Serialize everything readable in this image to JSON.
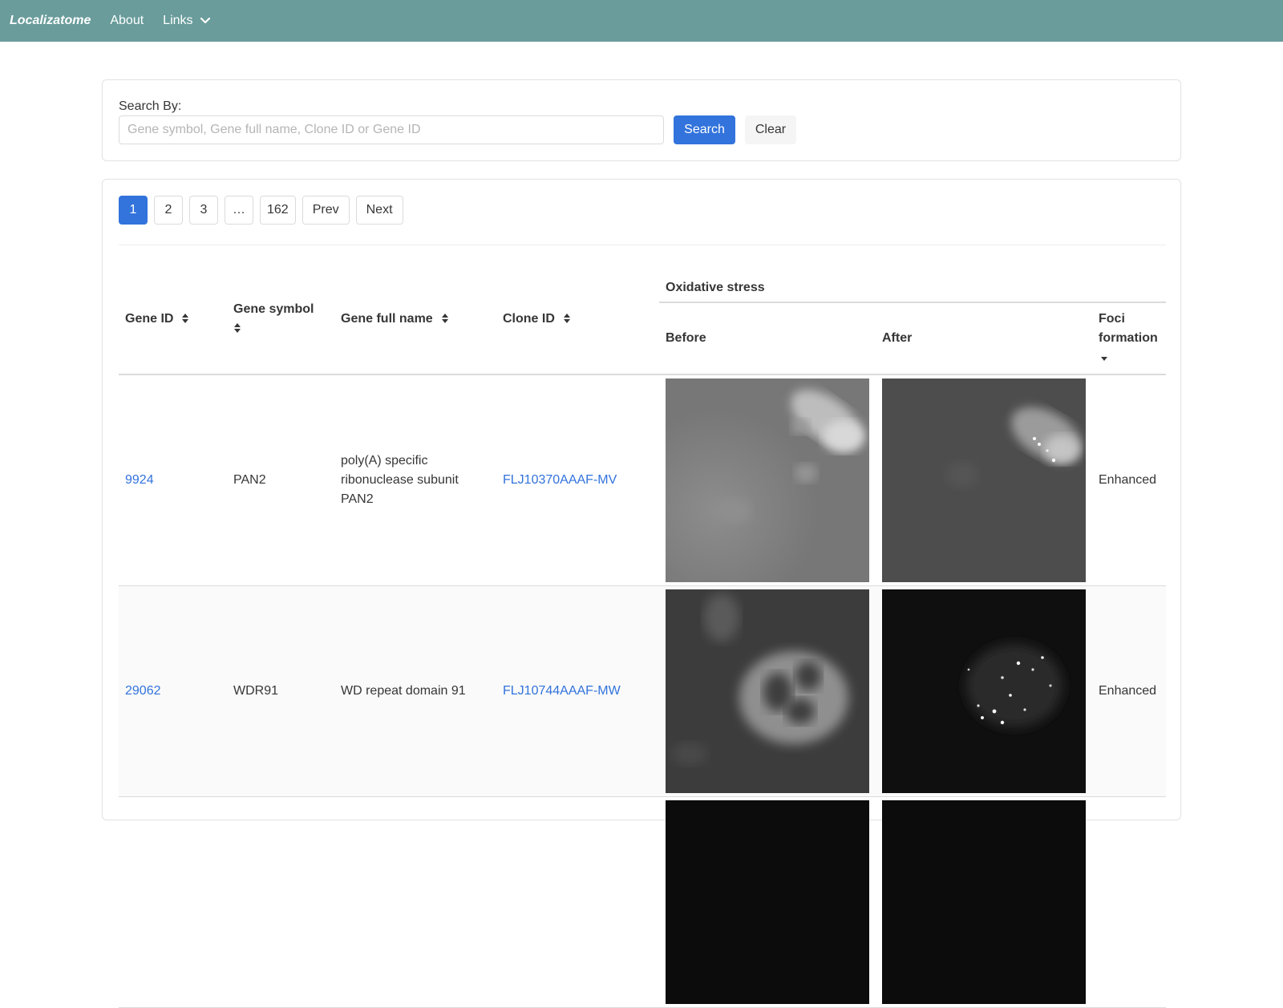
{
  "navbar": {
    "brand": "Localizatome",
    "about": "About",
    "links": "Links"
  },
  "search": {
    "label": "Search By:",
    "placeholder": "Gene symbol, Gene full name, Clone ID or Gene ID",
    "value": "",
    "search_label": "Search",
    "clear_label": "Clear"
  },
  "pagination": {
    "pages": [
      "1",
      "2",
      "3",
      "…",
      "162"
    ],
    "current": "1",
    "prev": "Prev",
    "next": "Next"
  },
  "table": {
    "headers": {
      "gene_id": "Gene ID",
      "gene_symbol": "Gene symbol",
      "gene_full_name": "Gene full name",
      "clone_id": "Clone ID",
      "group": "Oxidative stress",
      "before": "Before",
      "after": "After",
      "foci": "Foci formation"
    },
    "rows": [
      {
        "gene_id": "9924",
        "gene_symbol": "PAN2",
        "gene_full_name": "poly(A) specific ribonuclease subunit PAN2",
        "clone_id": "FLJ10370AAAF-MV",
        "foci": "Enhanced"
      },
      {
        "gene_id": "29062",
        "gene_symbol": "WDR91",
        "gene_full_name": "WD repeat domain 91",
        "clone_id": "FLJ10744AAAF-MW",
        "foci": "Enhanced"
      }
    ]
  },
  "colors": {
    "navbar": "#699c9b",
    "primary": "#3273dc",
    "link": "#3273dc"
  }
}
